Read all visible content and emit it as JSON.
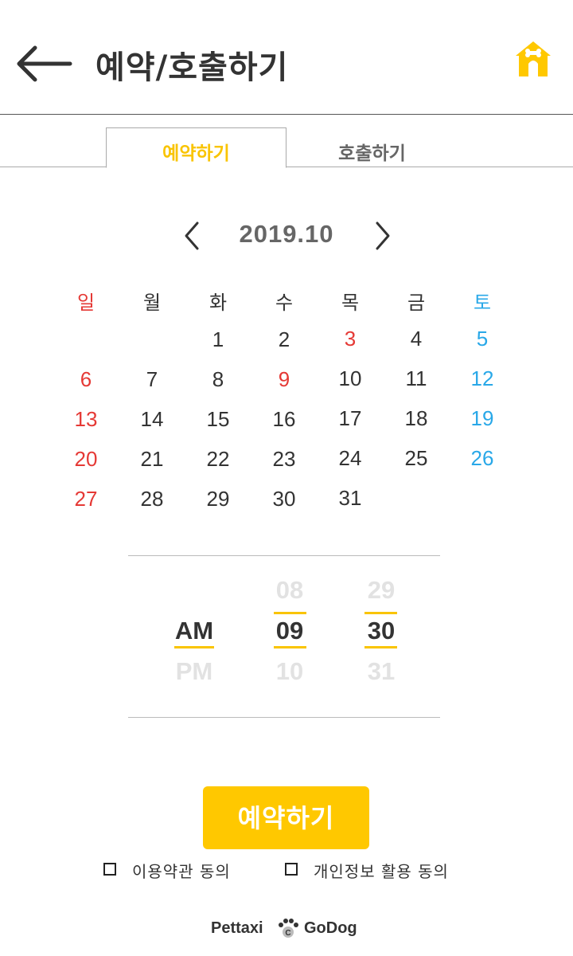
{
  "header": {
    "title": "예약/호출하기",
    "back_icon": "arrow-left-icon",
    "home_icon": "dog-house-icon"
  },
  "tabs": [
    {
      "label": "예약하기",
      "active": true
    },
    {
      "label": "호출하기",
      "active": false
    }
  ],
  "calendar": {
    "month_label": "2019.10",
    "prev_icon": "chevron-left-icon",
    "next_icon": "chevron-right-icon",
    "weekdays": [
      "일",
      "월",
      "화",
      "수",
      "목",
      "금",
      "토"
    ],
    "selected_day": "14",
    "days": [
      "1",
      "2",
      "3",
      "4",
      "5",
      "6",
      "7",
      "8",
      "9",
      "10",
      "11",
      "12",
      "13",
      "14",
      "15",
      "16",
      "17",
      "18",
      "19",
      "20",
      "21",
      "22",
      "23",
      "24",
      "25",
      "26",
      "27",
      "28",
      "29",
      "30",
      "31"
    ],
    "holidays": [
      "3",
      "9"
    ]
  },
  "time_picker": {
    "ampm": {
      "selected": "AM",
      "next": "PM"
    },
    "hour": {
      "prev": "08",
      "selected": "09",
      "next": "10"
    },
    "minute": {
      "prev": "29",
      "selected": "30",
      "next": "31"
    }
  },
  "reserve_button": "예약하기",
  "agreements": {
    "terms": "이용약관 동의",
    "privacy": "개인정보 활용 동의"
  },
  "footer": {
    "brand_left": "Pettaxi",
    "brand_right": "GoDog",
    "paw_icon": "paw-icon"
  },
  "colors": {
    "accent": "#ffc800",
    "sunday": "#e53935",
    "saturday": "#29a8e8",
    "text": "#333333"
  }
}
